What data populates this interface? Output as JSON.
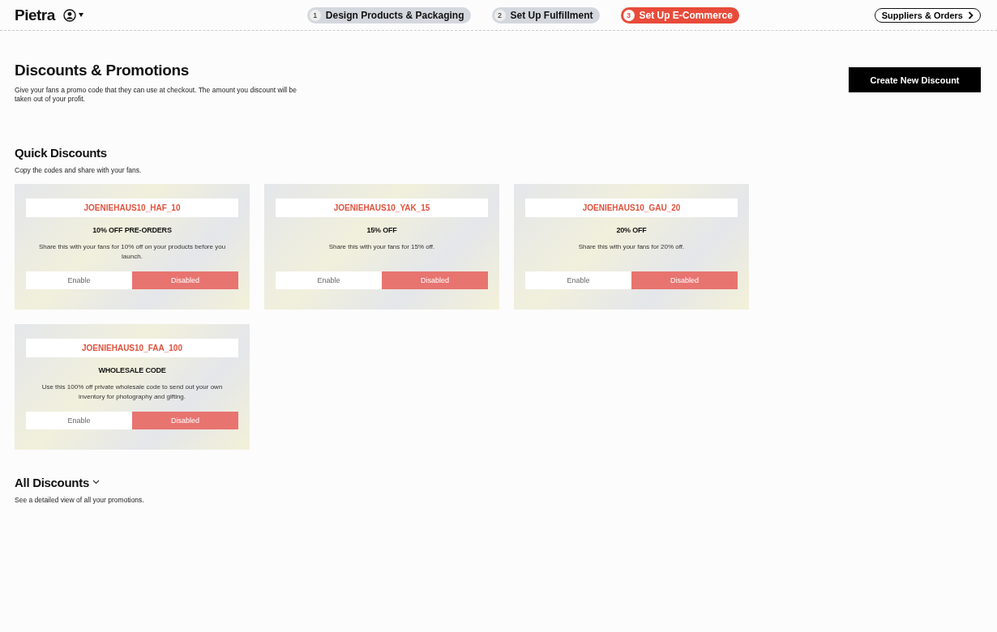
{
  "header": {
    "logo": "Pietra",
    "steps": [
      {
        "number": "1",
        "label": "Design Products & Packaging",
        "selected": false
      },
      {
        "number": "2",
        "label": "Set Up Fulfillment",
        "selected": false
      },
      {
        "number": "3",
        "label": "Set Up E-Commerce",
        "selected": true
      }
    ],
    "link": "Suppliers & Orders"
  },
  "page": {
    "title": "Discounts & Promotions",
    "description": "Give your fans a promo code that they can use at checkout. The amount you discount will be taken out of your profit.",
    "create_button": "Create New Discount"
  },
  "quick": {
    "title": "Quick Discounts",
    "subtitle": "Copy the codes and share with your fans.",
    "cards": [
      {
        "code": "JOENIEHAUS10_HAF_10",
        "heading": "10% OFF PRE-ORDERS",
        "text": "Share this with your fans for 10% off on your products before you launch.",
        "enable_label": "Enable",
        "disable_label": "Disabled",
        "enabled": false
      },
      {
        "code": "JOENIEHAUS10_YAK_15",
        "heading": "15% OFF",
        "text": "Share this with your fans for 15% off.",
        "enable_label": "Enable",
        "disable_label": "Disabled",
        "enabled": false
      },
      {
        "code": "JOENIEHAUS10_GAU_20",
        "heading": "20% OFF",
        "text": "Share this with your fans for 20% off.",
        "enable_label": "Enable",
        "disable_label": "Disabled",
        "enabled": false
      },
      {
        "code": "JOENIEHAUS10_FAA_100",
        "heading": "WHOLESALE CODE",
        "text": "Use this 100% off private wholesale code to send out your own inventory for photography and gifting.",
        "enable_label": "Enable",
        "disable_label": "Disabled",
        "enabled": false
      }
    ]
  },
  "all": {
    "title": "All Discounts",
    "subtitle": "See a detailed view of all your promotions."
  }
}
